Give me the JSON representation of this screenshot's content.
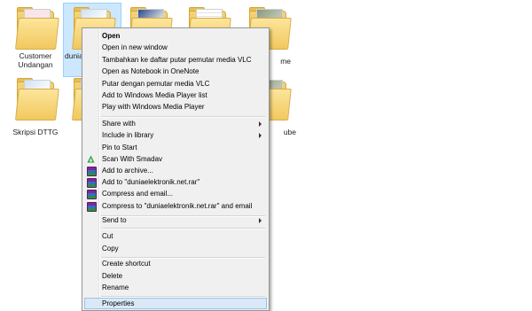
{
  "folders": [
    {
      "id": "customer-undangan",
      "label_lines": [
        "Customer",
        "Undangan"
      ],
      "paper": "pink",
      "selected": false
    },
    {
      "id": "duniaelektronik",
      "label_lines": [
        "dunia"
      ],
      "paper": "blue",
      "selected": true
    },
    {
      "id": "folder-3",
      "label_lines": [],
      "paper": "dark",
      "selected": false
    },
    {
      "id": "folder-4",
      "label_lines": [],
      "paper": "doc",
      "selected": false
    },
    {
      "id": "folder-5",
      "label_lines": [
        "me"
      ],
      "paper": "photo",
      "selected": false
    },
    {
      "id": "skripsi-dttg",
      "label_lines": [
        "Skripsi DTTG"
      ],
      "paper": "blue",
      "selected": false
    },
    {
      "id": "folder-7",
      "label_lines": [],
      "paper": "doc",
      "selected": false
    },
    {
      "id": "folder-8",
      "label_lines": [
        "ube"
      ],
      "paper": "photo",
      "selected": false
    }
  ],
  "context_menu": {
    "items": [
      {
        "label": "Open",
        "bold": true
      },
      {
        "label": "Open in new window"
      },
      {
        "label": "Tambahkan ke daftar putar pemutar media VLC"
      },
      {
        "label": "Open as Notebook in OneNote"
      },
      {
        "label": "Putar dengan pemutar media VLC"
      },
      {
        "label": "Add to Windows Media Player list"
      },
      {
        "label": "Play with Windows Media Player"
      },
      {
        "separator": true
      },
      {
        "label": "Share with",
        "submenu": true
      },
      {
        "label": "Include in library",
        "submenu": true
      },
      {
        "label": "Pin to Start"
      },
      {
        "label": "Scan With Smadav",
        "icon": "smadav-icon"
      },
      {
        "label": "Add to archive...",
        "icon": "winrar-icon"
      },
      {
        "label": "Add to \"duniaelektronik.net.rar\"",
        "icon": "winrar-icon"
      },
      {
        "label": "Compress and email...",
        "icon": "winrar-icon"
      },
      {
        "label": "Compress to \"duniaelektronik.net.rar\" and email",
        "icon": "winrar-icon"
      },
      {
        "separator": true
      },
      {
        "label": "Send to",
        "submenu": true
      },
      {
        "separator": true
      },
      {
        "label": "Cut"
      },
      {
        "label": "Copy"
      },
      {
        "separator": true
      },
      {
        "label": "Create shortcut"
      },
      {
        "label": "Delete"
      },
      {
        "label": "Rename"
      },
      {
        "separator": true
      },
      {
        "label": "Properties",
        "highlighted": true
      }
    ]
  },
  "colors": {
    "selection_bg": "#cce8ff",
    "menu_bg": "#f0f0f0",
    "menu_highlight": "#d9e9f8",
    "smadav_green": "#2a9a3a"
  }
}
